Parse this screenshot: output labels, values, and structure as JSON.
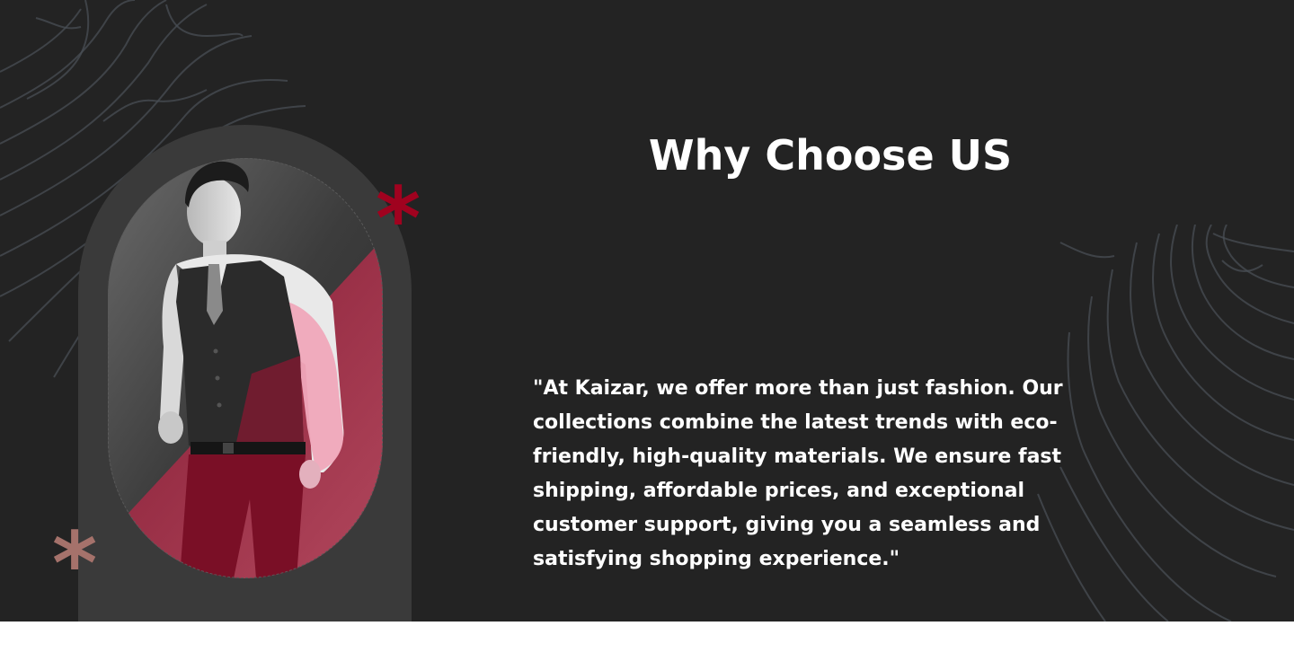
{
  "section": {
    "background_color": "#232323",
    "title": "Why Choose US",
    "description": "\"At Kaizar, we offer more than just fashion. Our collections combine the latest trends with eco-friendly, high-quality materials. We ensure fast shipping, affordable prices, and exceptional customer support, giving you a seamless and satisfying shopping experience.\"",
    "accent_color": "#a0021f",
    "secondary_accent_color": "#a5726b"
  },
  "icons": {
    "decoration_top": "asterisk-icon",
    "decoration_bottom": "asterisk-icon"
  },
  "decorative_glyphs": {
    "asterisk": "*"
  }
}
